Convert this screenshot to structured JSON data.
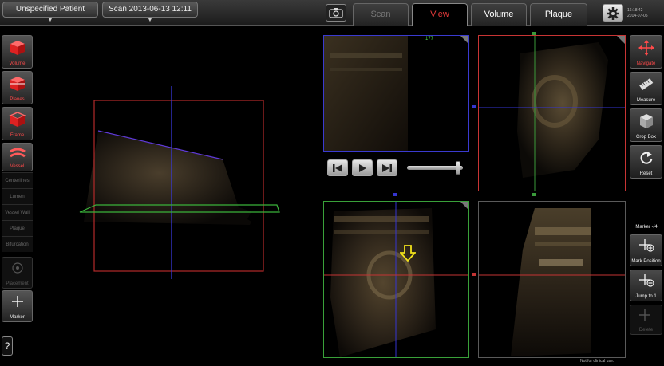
{
  "header": {
    "patient_label": "Unspecified Patient",
    "scan_label": "Scan 2013-06-13 12:11",
    "tabs": [
      {
        "label": "Scan",
        "state": "disabled"
      },
      {
        "label": "View",
        "state": "active"
      },
      {
        "label": "Volume",
        "state": "normal"
      },
      {
        "label": "Plaque",
        "state": "normal"
      }
    ],
    "time": "16:18:42",
    "date": "2014-07-05"
  },
  "left_tools": {
    "volume_label": "Volume",
    "planes_label": "Planes",
    "frame_label": "Frame",
    "vessel_label": "Vessel",
    "vessel_items": [
      "Centerlines",
      "Lumen",
      "Vessel Wall",
      "Plaque",
      "Bifurcation"
    ],
    "placement_label": "Placement",
    "marker_label": "Marker",
    "help_label": "?"
  },
  "right_tools": {
    "navigate_label": "Navigate",
    "measure_label": "Measure",
    "crop_box_label": "Crop Box",
    "reset_label": "Reset",
    "marker_count": "Marker -/4",
    "mark_position_label": "Mark Position",
    "jump_to_label": "Jump to 1",
    "delete_label": "Delete"
  },
  "viewports": {
    "frame_number": "177"
  },
  "playback": {
    "slider_position": 0.95
  },
  "footer": {
    "disclaimer": "Not for clinical use."
  },
  "colors": {
    "accent_red": "#e53a3a",
    "plane_red": "#c83434",
    "plane_blue": "#3a3ad0",
    "plane_green": "#39a039",
    "marker_yellow": "#f2e21a"
  }
}
